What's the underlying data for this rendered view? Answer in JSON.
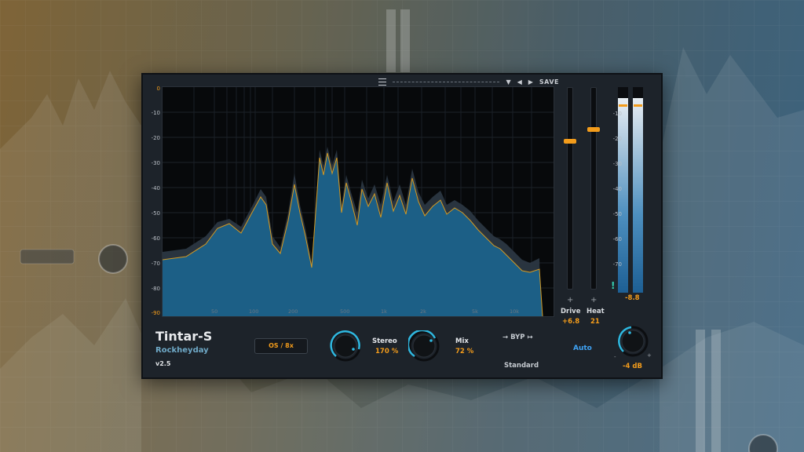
{
  "app": {
    "name": "Tintar-S",
    "vendor": "Rockheyday",
    "version": "v2.5"
  },
  "topbar": {
    "save_label": "SAVE"
  },
  "spectrum": {
    "y_labels": [
      "0",
      "-10",
      "-20",
      "-30",
      "-40",
      "-50",
      "-60",
      "-70",
      "-80",
      "-90"
    ],
    "x_labels": [
      "50",
      "100",
      "200",
      "500",
      "1k",
      "2k",
      "5k",
      "10k"
    ]
  },
  "faders": [
    {
      "name": "Drive",
      "value": "+6.8",
      "level": 0.73
    },
    {
      "name": "Heat",
      "value": "21",
      "level": 0.79
    }
  ],
  "output_meter": {
    "labels": [
      "-10",
      "-20",
      "-30",
      "-40",
      "-50",
      "-60",
      "-70"
    ],
    "readout": "-8.8"
  },
  "controls": {
    "oversampling_label": "OS / 8x",
    "stereo": {
      "label": "Stereo",
      "value": "170 %"
    },
    "mix": {
      "label": "Mix",
      "value": "72 %"
    },
    "bypass_label": "BYP",
    "mode_label": "Standard",
    "auto_label": "Auto",
    "output_value": "-4 dB"
  },
  "colors": {
    "accent": "#f39c1b",
    "blue": "#3fa3f5",
    "panel": "#1d232a"
  }
}
